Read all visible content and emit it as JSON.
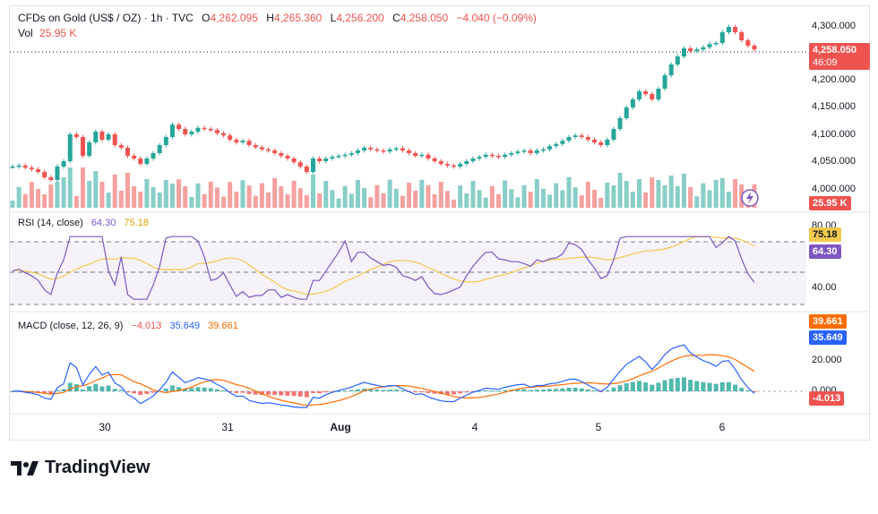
{
  "header": {
    "symbol": "CFDs on Gold (US$ / OZ) · 1h · TVC",
    "o_label": "O",
    "o_value": "4,262.095",
    "h_label": "H",
    "h_value": "4,265.360",
    "l_label": "L",
    "l_value": "4,256.200",
    "c_label": "C",
    "c_value": "4,258.050",
    "change": "−4.040 (−0.09%)",
    "vol_label": "Vol",
    "vol_value": "25.95 K"
  },
  "price_axis": [
    "4,300.000",
    "4,200.000",
    "4,150.000",
    "4,100.000",
    "4,050.000",
    "4,000.000"
  ],
  "price_tag": {
    "value": "4,258.050",
    "countdown": "46:09"
  },
  "vol_tag": "25.95 K",
  "rsi": {
    "label": "RSI (14, close)",
    "value": "64.30",
    "ma": "75.18",
    "axis": [
      "80.00",
      "40.00"
    ]
  },
  "macd": {
    "label": "MACD (close, 12, 26, 9)",
    "hist": "−4.013",
    "macd": "35.649",
    "signal": "39.661",
    "axis": [
      "20.000",
      "0.000"
    ],
    "tags": {
      "signal": "39.661",
      "macd": "35.649",
      "hist": "-4.013"
    }
  },
  "x_axis": [
    "30",
    "31",
    "Aug",
    "4",
    "5",
    "6"
  ],
  "brand": "TradingView",
  "colors": {
    "up": "#26a69a",
    "down": "#ef5350",
    "rsi": "#7e57c2",
    "rsi_ma": "#f2c94c",
    "macd": "#2962ff",
    "signal": "#ff6d00"
  },
  "chart_data": {
    "type": "candlestick",
    "closes": [
      4040,
      4042,
      4038,
      4035,
      4030,
      4020,
      4015,
      4040,
      4050,
      4100,
      4095,
      4060,
      4085,
      4105,
      4090,
      4100,
      4080,
      4075,
      4060,
      4055,
      4045,
      4055,
      4065,
      4080,
      4095,
      4118,
      4110,
      4100,
      4105,
      4112,
      4110,
      4108,
      4102,
      4098,
      4090,
      4085,
      4088,
      4080,
      4076,
      4072,
      4070,
      4065,
      4060,
      4055,
      4048,
      4040,
      4030,
      4055,
      4050,
      4055,
      4058,
      4060,
      4062,
      4065,
      4070,
      4075,
      4072,
      4070,
      4068,
      4072,
      4074,
      4070,
      4065,
      4060,
      4062,
      4055,
      4050,
      4045,
      4042,
      4040,
      4045,
      4050,
      4055,
      4058,
      4062,
      4060,
      4058,
      4062,
      4065,
      4068,
      4070,
      4065,
      4070,
      4072,
      4078,
      4082,
      4088,
      4095,
      4098,
      4095,
      4090,
      4085,
      4080,
      4090,
      4110,
      4130,
      4150,
      4165,
      4180,
      4175,
      4165,
      4185,
      4210,
      4230,
      4245,
      4260,
      4255,
      4258,
      4262,
      4268,
      4270,
      4290,
      4300,
      4290,
      4275,
      4265,
      4258
    ]
  }
}
